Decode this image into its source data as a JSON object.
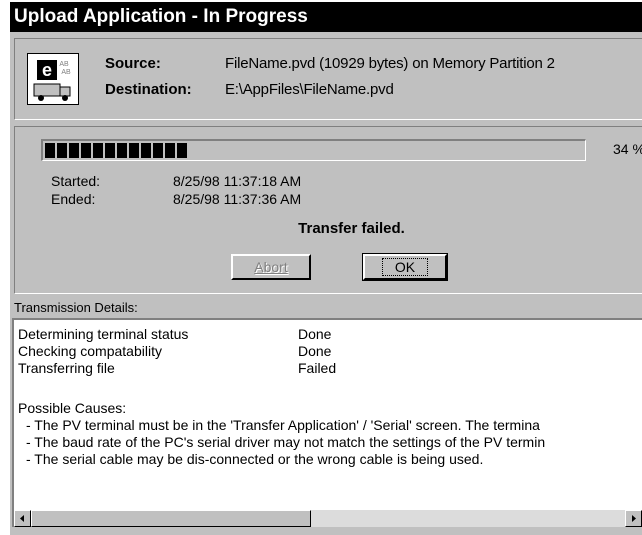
{
  "window": {
    "title": "Upload Application - In Progress"
  },
  "header": {
    "source_label": "Source:",
    "source_value": "FileName.pvd   (10929 bytes) on Memory Partition 2",
    "destination_label": "Destination:",
    "destination_value": "E:\\AppFiles\\FileName.pvd"
  },
  "progress": {
    "percent_text": "34 %",
    "fraction": 0.34,
    "segments": 12,
    "started_label": "Started:",
    "started_value": "8/25/98 11:37:18 AM",
    "ended_label": "Ended:",
    "ended_value": "8/25/98 11:37:36 AM",
    "status_message": "Transfer failed."
  },
  "buttons": {
    "abort_label": "Abort",
    "ok_label": "OK"
  },
  "details": {
    "label": "Transmission Details:",
    "steps": [
      {
        "name": "Determining terminal status",
        "status": "Done"
      },
      {
        "name": "Checking compatability",
        "status": "Done"
      },
      {
        "name": "Transferring file",
        "status": "Failed"
      }
    ],
    "causes_title": "Possible Causes:",
    "causes": [
      "- The PV terminal must be in the 'Transfer Application' / 'Serial' screen.  The termina",
      "- The baud rate of the PC's serial driver may not match the settings of the PV termin",
      "- The serial cable may be dis-connected or the wrong cable is being used."
    ]
  },
  "icons": {
    "app_icon": "download-truck-icon",
    "scroll_left": "arrow-left-icon",
    "scroll_right": "arrow-right-icon"
  }
}
